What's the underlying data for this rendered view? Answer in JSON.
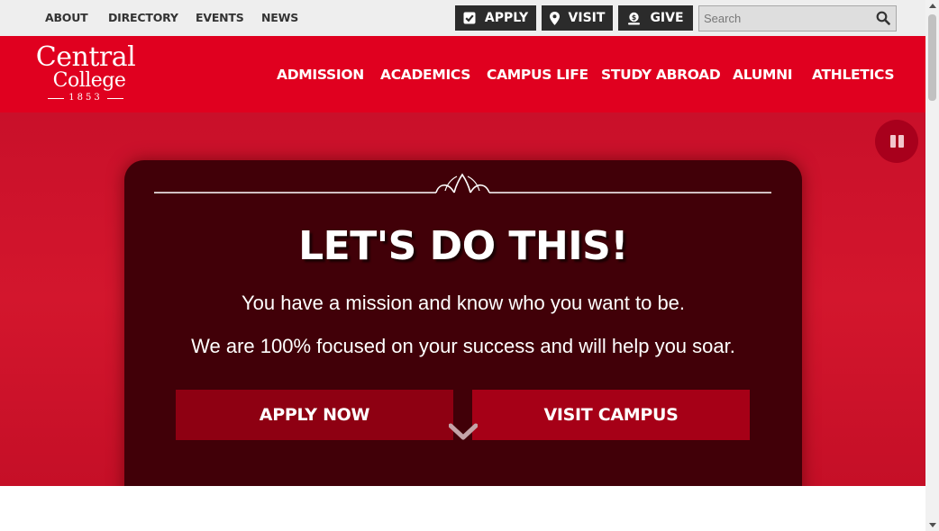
{
  "utility": {
    "links": [
      "ABOUT",
      "DIRECTORY",
      "EVENTS",
      "NEWS"
    ],
    "buttons": [
      {
        "label": "APPLY",
        "icon": "checkbox-icon"
      },
      {
        "label": "VISIT",
        "icon": "map-pin-icon"
      },
      {
        "label": "GIVE",
        "icon": "donate-icon"
      }
    ],
    "search": {
      "placeholder": "Search",
      "value": "",
      "icon": "search-icon"
    }
  },
  "logo": {
    "line1": "Central",
    "line2": "College",
    "year": "1853"
  },
  "nav": [
    "ADMISSION",
    "ACADEMICS",
    "CAMPUS LIFE",
    "STUDY ABROAD",
    "ALUMNI",
    "ATHLETICS"
  ],
  "hero": {
    "title": "LET'S DO THIS!",
    "line1": "You have a mission and know who you want to be.",
    "line2": "We are 100% focused on your success and will help you soar.",
    "cta_apply": "APPLY NOW",
    "cta_visit": "VISIT CAMPUS",
    "pause_icon": "pause-icon",
    "scroll_icon": "chevron-down-icon"
  },
  "colors": {
    "brand_red": "#e0001f",
    "hero_panel": "#410008",
    "utility_bg": "#eeeeee",
    "utility_button": "#2b2b2b"
  }
}
